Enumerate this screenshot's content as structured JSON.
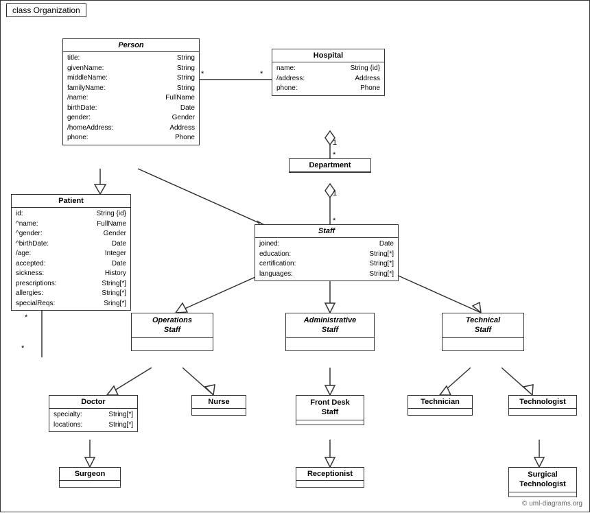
{
  "title": "class Organization",
  "classes": {
    "person": {
      "name": "Person",
      "italic": true,
      "attrs": [
        [
          "title:",
          "String"
        ],
        [
          "givenName:",
          "String"
        ],
        [
          "middleName:",
          "String"
        ],
        [
          "familyName:",
          "String"
        ],
        [
          "/name:",
          "FullName"
        ],
        [
          "birthDate:",
          "Date"
        ],
        [
          "gender:",
          "Gender"
        ],
        [
          "/homeAddress:",
          "Address"
        ],
        [
          "phone:",
          "Phone"
        ]
      ]
    },
    "hospital": {
      "name": "Hospital",
      "italic": false,
      "attrs": [
        [
          "name:",
          "String {id}"
        ],
        [
          "/address:",
          "Address"
        ],
        [
          "phone:",
          "Phone"
        ]
      ]
    },
    "patient": {
      "name": "Patient",
      "italic": false,
      "attrs": [
        [
          "id:",
          "String {id}"
        ],
        [
          "^name:",
          "FullName"
        ],
        [
          "^gender:",
          "Gender"
        ],
        [
          "^birthDate:",
          "Date"
        ],
        [
          "/age:",
          "Integer"
        ],
        [
          "accepted:",
          "Date"
        ],
        [
          "sickness:",
          "History"
        ],
        [
          "prescriptions:",
          "String[*]"
        ],
        [
          "allergies:",
          "String[*]"
        ],
        [
          "specialReqs:",
          "Sring[*]"
        ]
      ]
    },
    "department": {
      "name": "Department",
      "italic": false,
      "attrs": []
    },
    "staff": {
      "name": "Staff",
      "italic": true,
      "attrs": [
        [
          "joined:",
          "Date"
        ],
        [
          "education:",
          "String[*]"
        ],
        [
          "certification:",
          "String[*]"
        ],
        [
          "languages:",
          "String[*]"
        ]
      ]
    },
    "operations_staff": {
      "name": "Operations\nStaff",
      "italic": true,
      "attrs": []
    },
    "admin_staff": {
      "name": "Administrative\nStaff",
      "italic": true,
      "attrs": []
    },
    "technical_staff": {
      "name": "Technical\nStaff",
      "italic": true,
      "attrs": []
    },
    "doctor": {
      "name": "Doctor",
      "italic": false,
      "attrs": [
        [
          "specialty:",
          "String[*]"
        ],
        [
          "locations:",
          "String[*]"
        ]
      ]
    },
    "nurse": {
      "name": "Nurse",
      "italic": false,
      "attrs": []
    },
    "front_desk_staff": {
      "name": "Front Desk\nStaff",
      "italic": false,
      "attrs": []
    },
    "technician": {
      "name": "Technician",
      "italic": false,
      "attrs": []
    },
    "technologist": {
      "name": "Technologist",
      "italic": false,
      "attrs": []
    },
    "surgeon": {
      "name": "Surgeon",
      "italic": false,
      "attrs": []
    },
    "receptionist": {
      "name": "Receptionist",
      "italic": false,
      "attrs": []
    },
    "surgical_technologist": {
      "name": "Surgical\nTechnologist",
      "italic": false,
      "attrs": []
    }
  },
  "copyright": "© uml-diagrams.org"
}
